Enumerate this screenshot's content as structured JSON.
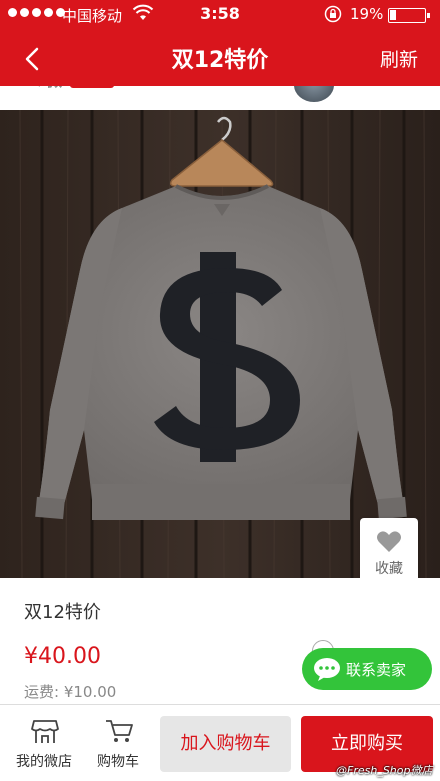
{
  "status_bar": {
    "carrier": "中国移动",
    "time": "3:58",
    "battery_percent": "19%",
    "icons": [
      "signal-dots-icon",
      "wifi-icon",
      "orientation-lock-icon",
      "battery-icon"
    ]
  },
  "nav": {
    "back_icon": "chevron-left-icon",
    "title": "双12特价",
    "refresh_label": "刷新"
  },
  "product": {
    "image_description_icon": "sweatshirt-dollar-image",
    "favorite_label": "收藏",
    "title": "双12特价",
    "price": "¥40.00",
    "shipping": "运费: ¥10.00"
  },
  "contact": {
    "label": "联系卖家",
    "icon": "chat-bubble-icon"
  },
  "bottom_bar": {
    "my_shop_label": "我的微店",
    "cart_tab_label": "购物车",
    "add_to_cart_label": "加入购物车",
    "buy_now_label": "立即购买"
  },
  "watermark": "@Fresh_Shop微店",
  "colors": {
    "brand_red": "#d9151c",
    "contact_green": "#33c43a",
    "price_red": "#d9151c"
  }
}
